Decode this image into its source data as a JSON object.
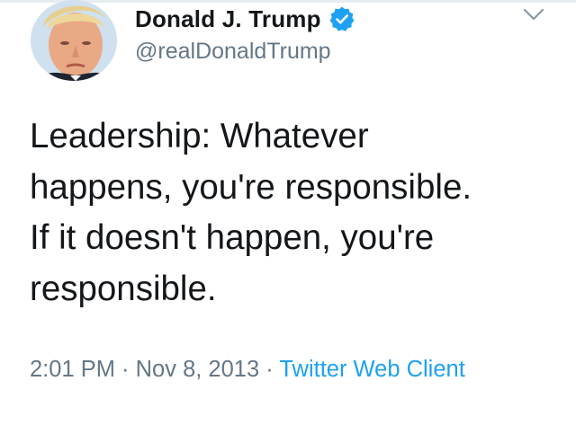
{
  "tweet": {
    "display_name": "Donald J. Trump",
    "handle": "@realDonaldTrump",
    "verified": true,
    "text": "Leadership: Whatever\nhappens, you're responsible.\nIf it doesn't happen, you're\nresponsible.",
    "time": "2:01 PM",
    "separator": " · ",
    "date": "Nov 8, 2013",
    "source": "Twitter Web Client"
  },
  "icons": {
    "avatar": "profile-photo",
    "verified": "verified-badge-icon",
    "caret": "chevron-down-icon"
  },
  "colors": {
    "name": "#14171a",
    "secondary": "#657786",
    "link": "#1da1f2",
    "verified_badge": "#1da1f2"
  }
}
